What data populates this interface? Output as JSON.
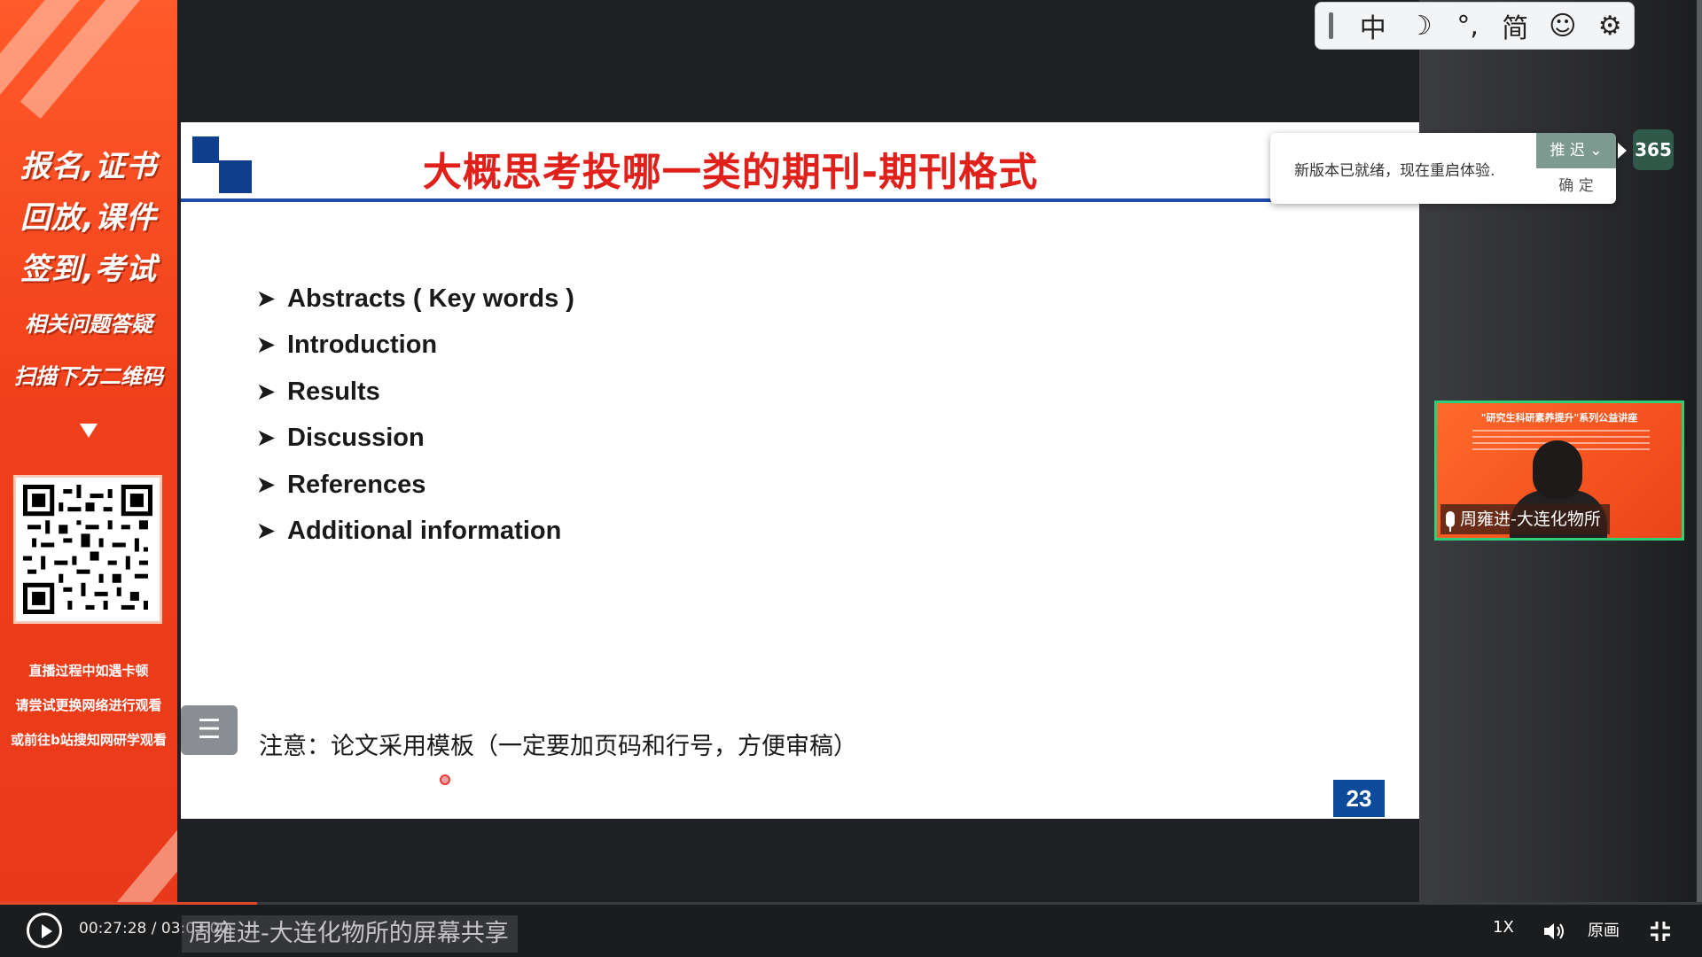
{
  "promo": {
    "lines_big": [
      "报名,证书",
      "回放,课件",
      "签到,考试"
    ],
    "lines_mid": [
      "相关问题答疑",
      "扫描下方二维码"
    ],
    "notes": [
      "直播过程中如遇卡顿",
      "请尝试更换网络进行观看",
      "或前往b站搜知网研学观看"
    ]
  },
  "slide": {
    "title": "大概思考投哪一类的期刊-期刊格式",
    "bullet_mark": "➤",
    "bullets": [
      "Abstracts ( Key words )",
      "Introduction",
      "Results",
      "Discussion",
      "References",
      "Additional information"
    ],
    "note": "注意：论文采用模板（一定要加页码和行号，方便审稿）",
    "page_number": "23"
  },
  "ime_toolbar": {
    "buttons": [
      {
        "label": "中",
        "icon": "chinese-mode-icon"
      },
      {
        "label": "☽",
        "icon": "moon-icon"
      },
      {
        "label": "°,",
        "icon": "punctuation-icon"
      },
      {
        "label": "简",
        "icon": "simplified-icon"
      },
      {
        "label": "☺",
        "icon": "emoji-icon"
      },
      {
        "label": "⚙",
        "icon": "settings-icon"
      }
    ]
  },
  "toast": {
    "message": "新版本已就绪，现在重启体验.",
    "later_label": "推 迟",
    "ok_label": "确 定"
  },
  "badge": "365",
  "video": {
    "banner": "\"研究生科研素养提升\"系列公益讲座",
    "speaker": "周雍进-大连化物所"
  },
  "player": {
    "progress": 0.151,
    "time": "00:27:28 / 03:03:00",
    "share_caption": "周雍进-大连化物所的屏幕共享",
    "speed": "1X",
    "quality": "原画"
  },
  "colors": {
    "promo": "#f0401b",
    "slide_title": "#e0201b",
    "slide_blue": "#0d4a9a",
    "speaker_border": "#2fcf7a"
  }
}
